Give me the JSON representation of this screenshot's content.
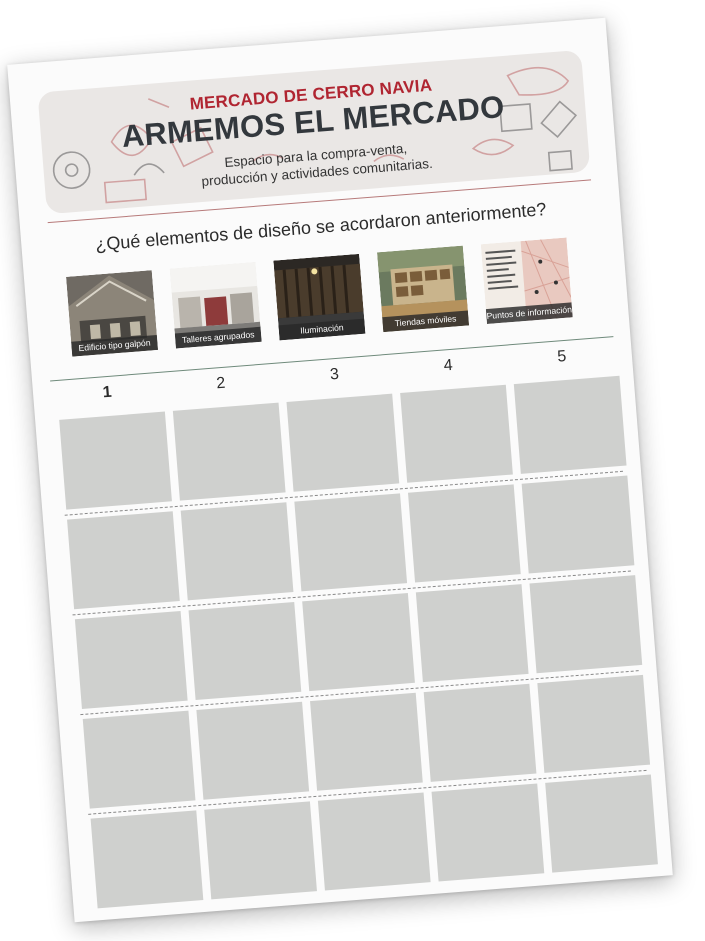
{
  "header": {
    "subtitle": "MERCADO DE CERRO NAVIA",
    "title": "ARMEMOS EL MERCADO",
    "description_line1": "Espacio para la compra-venta,",
    "description_line2": "producción y actividades comunitarias."
  },
  "question": "¿Qué elementos de diseño se acordaron anteriormente?",
  "design_elements": [
    {
      "label": "Edificio tipo galpón",
      "icon": "warehouse-photo"
    },
    {
      "label": "Talleres agrupados",
      "icon": "workshops-photo"
    },
    {
      "label": "Iluminación",
      "icon": "lighting-photo"
    },
    {
      "label": "Tiendas móviles",
      "icon": "mobile-stores-photo"
    },
    {
      "label": "Puntos de información",
      "icon": "info-map-photo"
    }
  ],
  "columns": [
    "1",
    "2",
    "3",
    "4",
    "5"
  ],
  "grid": {
    "rows": 5,
    "cols": 5
  },
  "colors": {
    "accent_red": "#b02531",
    "title_dark": "#33383d",
    "banner_bg": "#eae7e5",
    "cell_gray": "#cfd0ce"
  }
}
